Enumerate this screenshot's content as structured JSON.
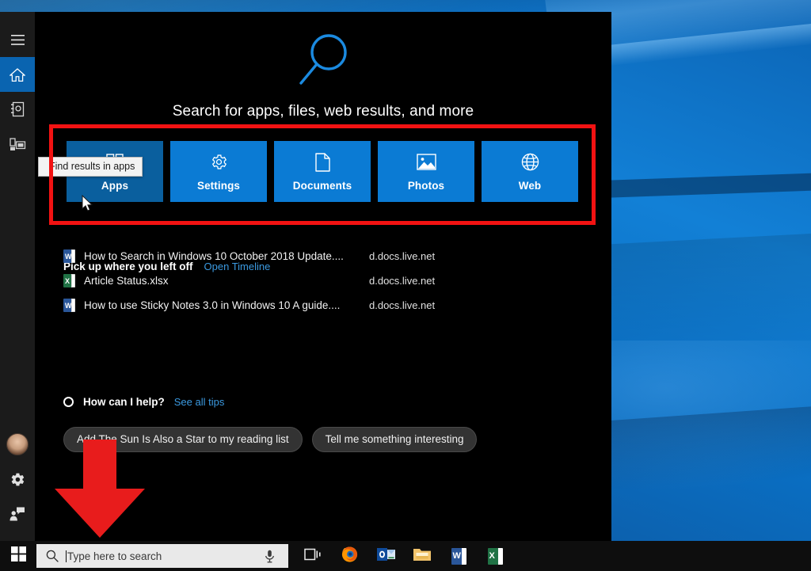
{
  "desktop": {
    "wallpaper_color": "#0b6bc4"
  },
  "search_panel": {
    "hero": {
      "icon": "magnifier-icon",
      "title": "Search for apps, files, web results, and more"
    },
    "rail": {
      "top_items": [
        {
          "name": "hamburger-menu",
          "icon": "hamburger-icon",
          "active": false
        },
        {
          "name": "home",
          "icon": "home-icon",
          "active": true
        },
        {
          "name": "notebook",
          "icon": "notebook-icon",
          "active": false
        },
        {
          "name": "collections",
          "icon": "collections-icon",
          "active": false
        }
      ],
      "bottom_items": [
        {
          "name": "account",
          "icon": "avatar-icon"
        },
        {
          "name": "settings",
          "icon": "gear-icon"
        },
        {
          "name": "feedback",
          "icon": "feedback-icon"
        }
      ]
    },
    "filter_tiles": [
      {
        "label": "Apps",
        "icon": "apps-icon",
        "hovered": true
      },
      {
        "label": "Settings",
        "icon": "gear-icon",
        "hovered": false
      },
      {
        "label": "Documents",
        "icon": "document-icon",
        "hovered": false
      },
      {
        "label": "Photos",
        "icon": "photo-icon",
        "hovered": false
      },
      {
        "label": "Web",
        "icon": "globe-icon",
        "hovered": false
      }
    ],
    "tooltip": {
      "text": "Find results in apps"
    },
    "timeline": {
      "title": "Pick up where you left off",
      "link": "Open Timeline",
      "items": [
        {
          "icon": "word-file-icon",
          "name": "How to Search in Windows 10 October 2018 Update....",
          "source": "d.docs.live.net"
        },
        {
          "icon": "excel-file-icon",
          "name": "Article Status.xlsx",
          "source": "d.docs.live.net"
        },
        {
          "icon": "word-file-icon",
          "name": "How to use Sticky Notes 3.0 in Windows 10 A guide....",
          "source": "d.docs.live.net"
        }
      ]
    },
    "cortana": {
      "icon": "cortana-ring-icon",
      "title": "How can I help?",
      "link": "See all tips",
      "chips": [
        "Add The Sun Is Also a Star to my reading list",
        "Tell me something interesting"
      ]
    }
  },
  "annotations": {
    "highlight_box": {
      "color": "#f21212",
      "name": "filter-tiles-highlight"
    },
    "arrow": {
      "color": "#e81c1c",
      "name": "down-arrow-annotation",
      "direction": "down"
    }
  },
  "taskbar": {
    "start": {
      "icon": "windows-start-icon"
    },
    "search": {
      "icon": "search-icon",
      "placeholder": "Type here to search",
      "value": "",
      "mic_icon": "microphone-icon"
    },
    "icons": [
      {
        "name": "task-view",
        "icon": "task-view-icon"
      },
      {
        "name": "firefox",
        "icon": "firefox-icon"
      },
      {
        "name": "outlook",
        "icon": "outlook-icon"
      },
      {
        "name": "file-explorer",
        "icon": "folder-icon"
      },
      {
        "name": "word",
        "icon": "word-icon",
        "glyph": "W"
      },
      {
        "name": "excel",
        "icon": "excel-icon",
        "glyph": "X"
      }
    ]
  }
}
